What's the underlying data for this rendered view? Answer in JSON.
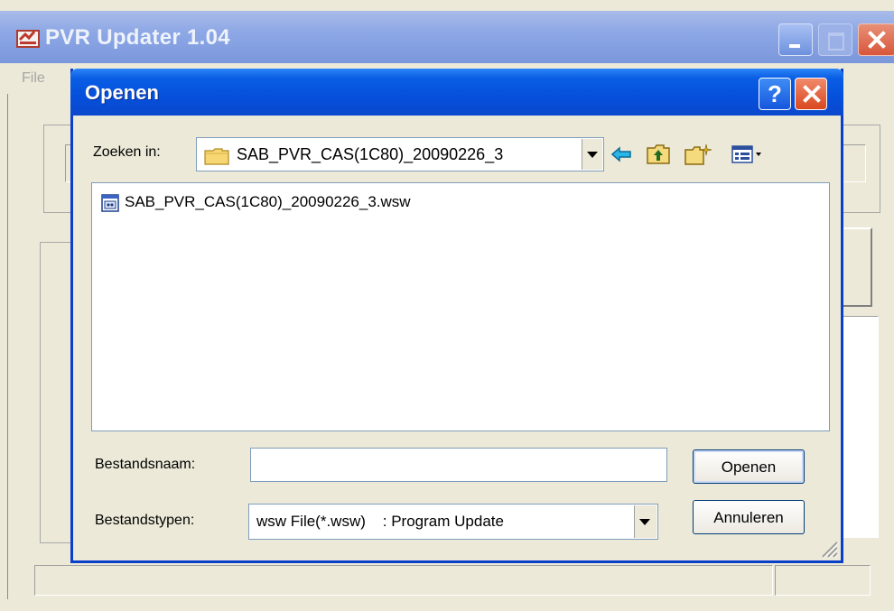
{
  "main_window": {
    "title": "PVR Updater 1.04",
    "menu": [
      "File"
    ]
  },
  "dialog": {
    "title": "Openen",
    "look_in": {
      "label": "Zoeken in:",
      "value": "SAB_PVR_CAS(1C80)_20090226_3"
    },
    "toolbar": [
      "back-arrow-icon",
      "up-folder-icon",
      "new-folder-icon",
      "view-menu-icon"
    ],
    "files": [
      {
        "name": "SAB_PVR_CAS(1C80)_20090226_3.wsw",
        "icon": "wsw-file-icon"
      }
    ],
    "file_name": {
      "label": "Bestandsnaam:",
      "value": ""
    },
    "file_type": {
      "label": "Bestandstypen:",
      "value": "wsw File(*.wsw)    : Program Update"
    },
    "buttons": {
      "open": "Openen",
      "cancel": "Annuleren"
    }
  },
  "colors": {
    "titlebar_blue": "#0550dc",
    "close_red": "#d9481f",
    "window_bg": "#ece9d8"
  }
}
